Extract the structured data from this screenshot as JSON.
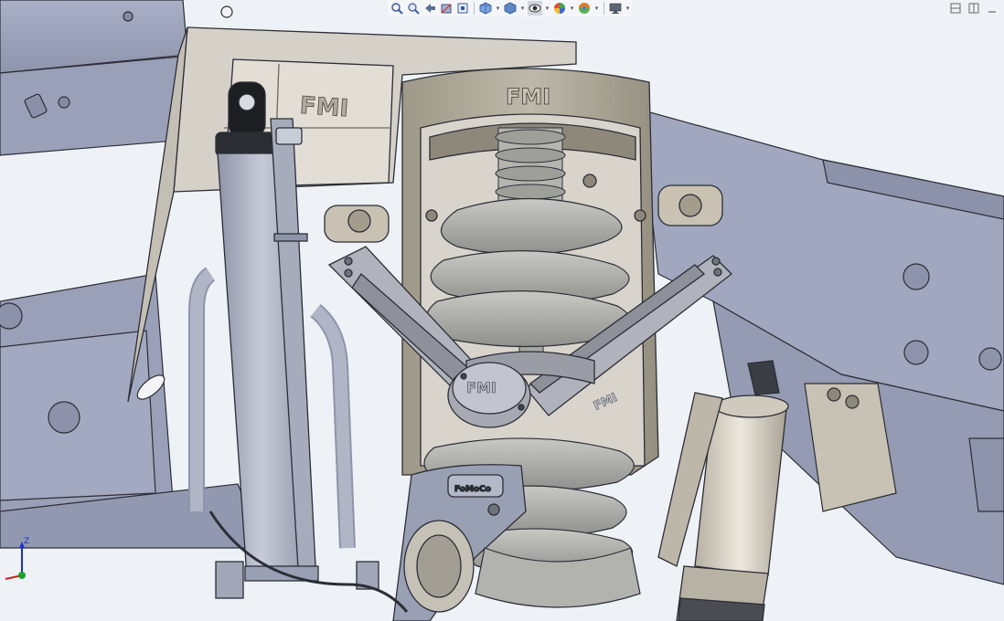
{
  "viewport": {
    "toolbar_icons": [
      "zoom-to-fit-icon",
      "zoom-area-icon",
      "previous-view-icon",
      "section-view-icon",
      "dynamic-annotation-icon",
      "view-orientation-icon",
      "display-style-icon",
      "hide-show-items-icon",
      "edit-appearance-icon",
      "apply-scene-icon",
      "view-settings-icon"
    ],
    "window_controls": [
      "tile-horizontal-icon",
      "tile-vertical-icon",
      "minimize-icon"
    ],
    "triad": {
      "z_label": "Z"
    }
  },
  "model": {
    "brand_bracket": "FMI",
    "brand_tower": "FMI",
    "brand_arm_cap": "FMI",
    "brand_arm": "FMI",
    "knuckle_stamp": "FoMoCo"
  },
  "colors": {
    "frame": "#9da4bb",
    "frame_dark": "#7f869e",
    "bracket": "#d6d1c8",
    "tower": "#aca698",
    "shock_body": "#b4b9c8",
    "spring": "#a9a9a5",
    "arm": "#b0b2bc",
    "reservoir": "#ddd8cc",
    "edge": "#2b2e36"
  }
}
